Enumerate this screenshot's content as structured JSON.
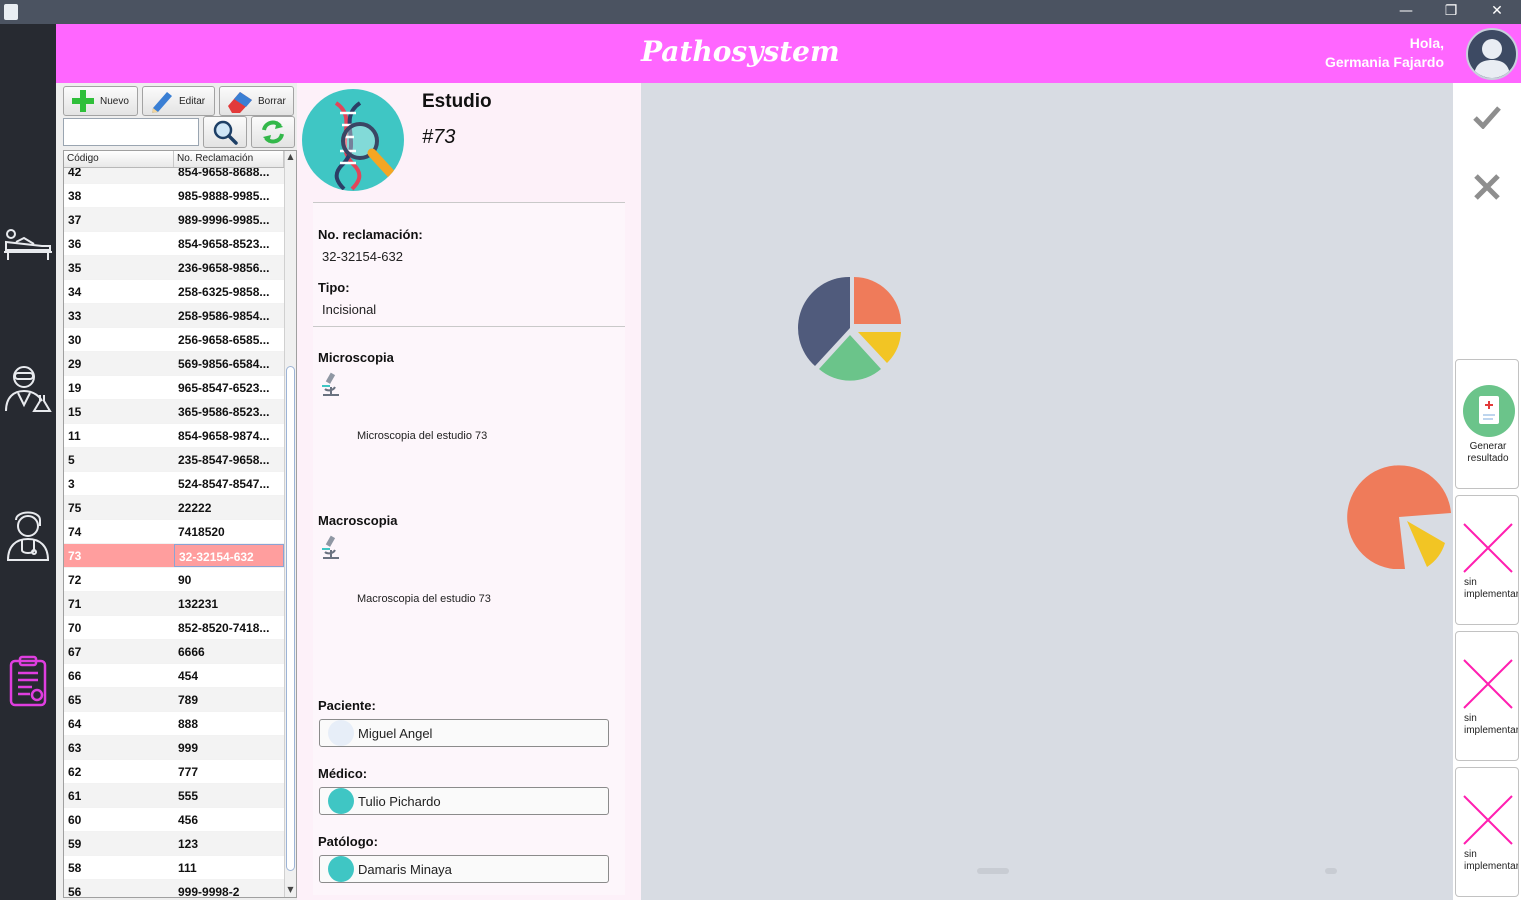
{
  "window": {
    "controls": {
      "minimize": "—",
      "restore": "❐",
      "close": "✕"
    }
  },
  "header": {
    "logo": "Pathosystem",
    "greeting_line1": "Hola,",
    "greeting_line2": "Germania Fajardo"
  },
  "nav": [
    "patient-icon",
    "lab-technician-icon",
    "doctor-icon",
    "clipboard-icon"
  ],
  "toolbar": {
    "new_label": "Nuevo",
    "edit_label": "Editar",
    "delete_label": "Borrar"
  },
  "search": {
    "value": ""
  },
  "table": {
    "columns": [
      "Código",
      "No. Reclamación"
    ],
    "rows": [
      [
        "42",
        "854-9658-8688..."
      ],
      [
        "38",
        "985-9888-9985..."
      ],
      [
        "37",
        "989-9996-9985..."
      ],
      [
        "36",
        "854-9658-8523..."
      ],
      [
        "35",
        "236-9658-9856..."
      ],
      [
        "34",
        "258-6325-9858..."
      ],
      [
        "33",
        "258-9586-9854..."
      ],
      [
        "30",
        "256-9658-6585..."
      ],
      [
        "29",
        "569-9856-6584..."
      ],
      [
        "19",
        "965-8547-6523..."
      ],
      [
        "15",
        "365-9586-8523..."
      ],
      [
        "11",
        "854-9658-9874..."
      ],
      [
        "5",
        "235-8547-9658..."
      ],
      [
        "3",
        "524-8547-8547..."
      ],
      [
        "75",
        "22222"
      ],
      [
        "74",
        "7418520"
      ],
      [
        "73",
        "32-32154-632"
      ],
      [
        "72",
        "90"
      ],
      [
        "71",
        "132231"
      ],
      [
        "70",
        "852-8520-7418..."
      ],
      [
        "67",
        "6666"
      ],
      [
        "66",
        "454"
      ],
      [
        "65",
        "789"
      ],
      [
        "64",
        "888"
      ],
      [
        "63",
        "999"
      ],
      [
        "62",
        "777"
      ],
      [
        "61",
        "555"
      ],
      [
        "60",
        "456"
      ],
      [
        "59",
        "123"
      ],
      [
        "58",
        "111"
      ],
      [
        "56",
        "999-9998-2"
      ]
    ],
    "selected_codigo": "73"
  },
  "detail": {
    "title": "Estudio",
    "number": "#73",
    "reclamacion_label": "No. reclamación:",
    "reclamacion_value": "32-32154-632",
    "tipo_label": "Tipo:",
    "tipo_value": "Incisional",
    "micro_label": "Microscopia",
    "micro_text": "Microscopia del estudio 73",
    "macro_label": "Macroscopia",
    "macro_text": "Macroscopia del estudio 73",
    "paciente_label": "Paciente:",
    "paciente_value": "Miguel Angel",
    "medico_label": "Médico:",
    "medico_value": "Tulio Pichardo",
    "patologo_label": "Patólogo:",
    "patologo_value": "Damaris Minaya"
  },
  "right_panel": {
    "generate_label_1": "Generar",
    "generate_label_2": "resultado",
    "placeholder_1": "sin",
    "placeholder_2": "implementar"
  },
  "colors": {
    "header": "#ff66ff",
    "nav_bg": "#272a31",
    "selected_row": "#ff9e9e",
    "pie_blue": "#505b7c",
    "pie_orange": "#ef7b5a",
    "pie_green": "#6bc48a",
    "pie_yellow": "#f2c524"
  }
}
